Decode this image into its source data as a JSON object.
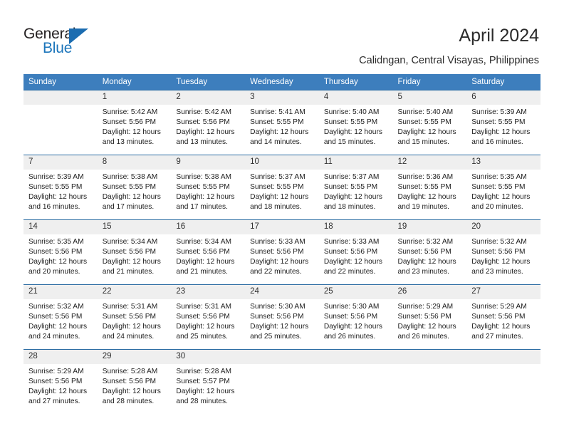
{
  "brand": {
    "name_part1": "General",
    "name_part2": "Blue",
    "accent_color": "#1b75bb"
  },
  "header": {
    "title": "April 2024",
    "subtitle": "Calidngan, Central Visayas, Philippines"
  },
  "calendar": {
    "header_color": "#3d7ebd",
    "daynum_bg": "#efefef",
    "weekdays": [
      "Sunday",
      "Monday",
      "Tuesday",
      "Wednesday",
      "Thursday",
      "Friday",
      "Saturday"
    ],
    "weeks": [
      [
        {
          "day": "",
          "sunrise": "",
          "sunset": "",
          "daylight_1": "",
          "daylight_2": ""
        },
        {
          "day": "1",
          "sunrise": "Sunrise: 5:42 AM",
          "sunset": "Sunset: 5:56 PM",
          "daylight_1": "Daylight: 12 hours",
          "daylight_2": "and 13 minutes."
        },
        {
          "day": "2",
          "sunrise": "Sunrise: 5:42 AM",
          "sunset": "Sunset: 5:56 PM",
          "daylight_1": "Daylight: 12 hours",
          "daylight_2": "and 13 minutes."
        },
        {
          "day": "3",
          "sunrise": "Sunrise: 5:41 AM",
          "sunset": "Sunset: 5:55 PM",
          "daylight_1": "Daylight: 12 hours",
          "daylight_2": "and 14 minutes."
        },
        {
          "day": "4",
          "sunrise": "Sunrise: 5:40 AM",
          "sunset": "Sunset: 5:55 PM",
          "daylight_1": "Daylight: 12 hours",
          "daylight_2": "and 15 minutes."
        },
        {
          "day": "5",
          "sunrise": "Sunrise: 5:40 AM",
          "sunset": "Sunset: 5:55 PM",
          "daylight_1": "Daylight: 12 hours",
          "daylight_2": "and 15 minutes."
        },
        {
          "day": "6",
          "sunrise": "Sunrise: 5:39 AM",
          "sunset": "Sunset: 5:55 PM",
          "daylight_1": "Daylight: 12 hours",
          "daylight_2": "and 16 minutes."
        }
      ],
      [
        {
          "day": "7",
          "sunrise": "Sunrise: 5:39 AM",
          "sunset": "Sunset: 5:55 PM",
          "daylight_1": "Daylight: 12 hours",
          "daylight_2": "and 16 minutes."
        },
        {
          "day": "8",
          "sunrise": "Sunrise: 5:38 AM",
          "sunset": "Sunset: 5:55 PM",
          "daylight_1": "Daylight: 12 hours",
          "daylight_2": "and 17 minutes."
        },
        {
          "day": "9",
          "sunrise": "Sunrise: 5:38 AM",
          "sunset": "Sunset: 5:55 PM",
          "daylight_1": "Daylight: 12 hours",
          "daylight_2": "and 17 minutes."
        },
        {
          "day": "10",
          "sunrise": "Sunrise: 5:37 AM",
          "sunset": "Sunset: 5:55 PM",
          "daylight_1": "Daylight: 12 hours",
          "daylight_2": "and 18 minutes."
        },
        {
          "day": "11",
          "sunrise": "Sunrise: 5:37 AM",
          "sunset": "Sunset: 5:55 PM",
          "daylight_1": "Daylight: 12 hours",
          "daylight_2": "and 18 minutes."
        },
        {
          "day": "12",
          "sunrise": "Sunrise: 5:36 AM",
          "sunset": "Sunset: 5:55 PM",
          "daylight_1": "Daylight: 12 hours",
          "daylight_2": "and 19 minutes."
        },
        {
          "day": "13",
          "sunrise": "Sunrise: 5:35 AM",
          "sunset": "Sunset: 5:55 PM",
          "daylight_1": "Daylight: 12 hours",
          "daylight_2": "and 20 minutes."
        }
      ],
      [
        {
          "day": "14",
          "sunrise": "Sunrise: 5:35 AM",
          "sunset": "Sunset: 5:56 PM",
          "daylight_1": "Daylight: 12 hours",
          "daylight_2": "and 20 minutes."
        },
        {
          "day": "15",
          "sunrise": "Sunrise: 5:34 AM",
          "sunset": "Sunset: 5:56 PM",
          "daylight_1": "Daylight: 12 hours",
          "daylight_2": "and 21 minutes."
        },
        {
          "day": "16",
          "sunrise": "Sunrise: 5:34 AM",
          "sunset": "Sunset: 5:56 PM",
          "daylight_1": "Daylight: 12 hours",
          "daylight_2": "and 21 minutes."
        },
        {
          "day": "17",
          "sunrise": "Sunrise: 5:33 AM",
          "sunset": "Sunset: 5:56 PM",
          "daylight_1": "Daylight: 12 hours",
          "daylight_2": "and 22 minutes."
        },
        {
          "day": "18",
          "sunrise": "Sunrise: 5:33 AM",
          "sunset": "Sunset: 5:56 PM",
          "daylight_1": "Daylight: 12 hours",
          "daylight_2": "and 22 minutes."
        },
        {
          "day": "19",
          "sunrise": "Sunrise: 5:32 AM",
          "sunset": "Sunset: 5:56 PM",
          "daylight_1": "Daylight: 12 hours",
          "daylight_2": "and 23 minutes."
        },
        {
          "day": "20",
          "sunrise": "Sunrise: 5:32 AM",
          "sunset": "Sunset: 5:56 PM",
          "daylight_1": "Daylight: 12 hours",
          "daylight_2": "and 23 minutes."
        }
      ],
      [
        {
          "day": "21",
          "sunrise": "Sunrise: 5:32 AM",
          "sunset": "Sunset: 5:56 PM",
          "daylight_1": "Daylight: 12 hours",
          "daylight_2": "and 24 minutes."
        },
        {
          "day": "22",
          "sunrise": "Sunrise: 5:31 AM",
          "sunset": "Sunset: 5:56 PM",
          "daylight_1": "Daylight: 12 hours",
          "daylight_2": "and 24 minutes."
        },
        {
          "day": "23",
          "sunrise": "Sunrise: 5:31 AM",
          "sunset": "Sunset: 5:56 PM",
          "daylight_1": "Daylight: 12 hours",
          "daylight_2": "and 25 minutes."
        },
        {
          "day": "24",
          "sunrise": "Sunrise: 5:30 AM",
          "sunset": "Sunset: 5:56 PM",
          "daylight_1": "Daylight: 12 hours",
          "daylight_2": "and 25 minutes."
        },
        {
          "day": "25",
          "sunrise": "Sunrise: 5:30 AM",
          "sunset": "Sunset: 5:56 PM",
          "daylight_1": "Daylight: 12 hours",
          "daylight_2": "and 26 minutes."
        },
        {
          "day": "26",
          "sunrise": "Sunrise: 5:29 AM",
          "sunset": "Sunset: 5:56 PM",
          "daylight_1": "Daylight: 12 hours",
          "daylight_2": "and 26 minutes."
        },
        {
          "day": "27",
          "sunrise": "Sunrise: 5:29 AM",
          "sunset": "Sunset: 5:56 PM",
          "daylight_1": "Daylight: 12 hours",
          "daylight_2": "and 27 minutes."
        }
      ],
      [
        {
          "day": "28",
          "sunrise": "Sunrise: 5:29 AM",
          "sunset": "Sunset: 5:56 PM",
          "daylight_1": "Daylight: 12 hours",
          "daylight_2": "and 27 minutes."
        },
        {
          "day": "29",
          "sunrise": "Sunrise: 5:28 AM",
          "sunset": "Sunset: 5:56 PM",
          "daylight_1": "Daylight: 12 hours",
          "daylight_2": "and 28 minutes."
        },
        {
          "day": "30",
          "sunrise": "Sunrise: 5:28 AM",
          "sunset": "Sunset: 5:57 PM",
          "daylight_1": "Daylight: 12 hours",
          "daylight_2": "and 28 minutes."
        },
        {
          "day": "",
          "sunrise": "",
          "sunset": "",
          "daylight_1": "",
          "daylight_2": ""
        },
        {
          "day": "",
          "sunrise": "",
          "sunset": "",
          "daylight_1": "",
          "daylight_2": ""
        },
        {
          "day": "",
          "sunrise": "",
          "sunset": "",
          "daylight_1": "",
          "daylight_2": ""
        },
        {
          "day": "",
          "sunrise": "",
          "sunset": "",
          "daylight_1": "",
          "daylight_2": ""
        }
      ]
    ]
  }
}
